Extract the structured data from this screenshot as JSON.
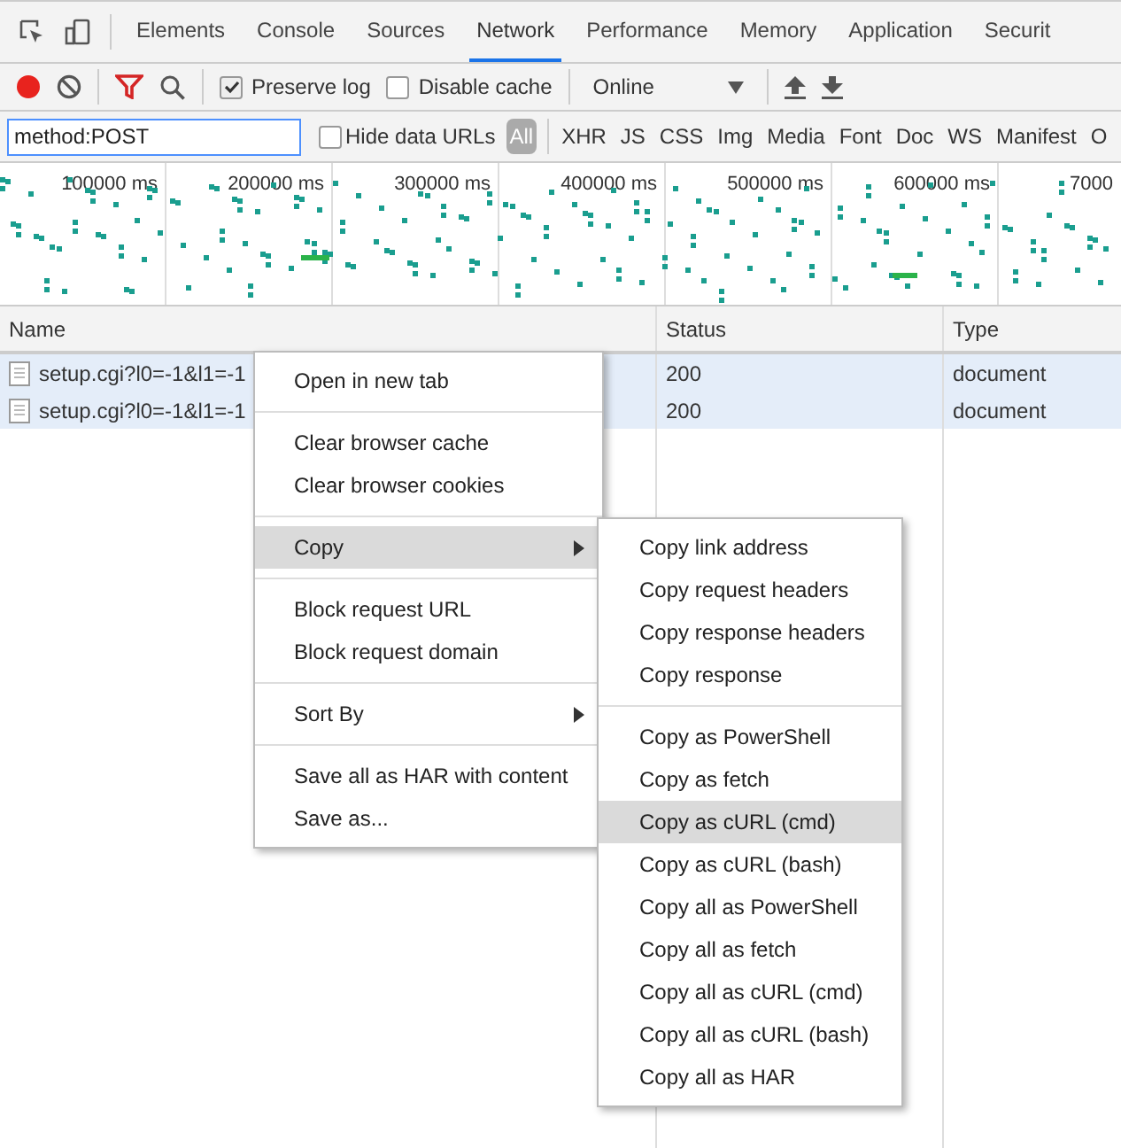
{
  "tabs": [
    {
      "label": "Elements",
      "selected": false
    },
    {
      "label": "Console",
      "selected": false
    },
    {
      "label": "Sources",
      "selected": false
    },
    {
      "label": "Network",
      "selected": true
    },
    {
      "label": "Performance",
      "selected": false
    },
    {
      "label": "Memory",
      "selected": false
    },
    {
      "label": "Application",
      "selected": false
    },
    {
      "label": "Securit",
      "selected": false
    }
  ],
  "toolbar": {
    "recording": true,
    "preserve_log": {
      "label": "Preserve log",
      "checked": true
    },
    "disable_cache": {
      "label": "Disable cache",
      "checked": false
    },
    "throttling": "Online"
  },
  "filter": {
    "value": "method:POST",
    "hide_data_urls": {
      "label": "Hide data URLs",
      "checked": false
    },
    "types": [
      {
        "label": "All",
        "selected": true
      },
      {
        "label": "XHR",
        "selected": false
      },
      {
        "label": "JS",
        "selected": false
      },
      {
        "label": "CSS",
        "selected": false
      },
      {
        "label": "Img",
        "selected": false
      },
      {
        "label": "Media",
        "selected": false
      },
      {
        "label": "Font",
        "selected": false
      },
      {
        "label": "Doc",
        "selected": false
      },
      {
        "label": "WS",
        "selected": false
      },
      {
        "label": "Manifest",
        "selected": false
      },
      {
        "label": "O",
        "selected": false
      }
    ]
  },
  "overview": {
    "ticks": [
      "100000 ms",
      "200000 ms",
      "300000 ms",
      "400000 ms",
      "500000 ms",
      "600000 ms",
      "7000"
    ]
  },
  "table": {
    "columns": [
      "Name",
      "Status",
      "Type"
    ],
    "rows": [
      {
        "name": "setup.cgi?l0=-1&l1=-1",
        "status": "200",
        "type": "document",
        "selected": true
      },
      {
        "name": "setup.cgi?l0=-1&l1=-1",
        "status": "200",
        "type": "document",
        "selected": true
      }
    ]
  },
  "context_menu": {
    "groups": [
      [
        {
          "label": "Open in new tab",
          "highlighted": false,
          "submenu": false
        }
      ],
      [
        {
          "label": "Clear browser cache",
          "highlighted": false,
          "submenu": false
        },
        {
          "label": "Clear browser cookies",
          "highlighted": false,
          "submenu": false
        }
      ],
      [
        {
          "label": "Copy",
          "highlighted": true,
          "submenu": true
        }
      ],
      [
        {
          "label": "Block request URL",
          "highlighted": false,
          "submenu": false
        },
        {
          "label": "Block request domain",
          "highlighted": false,
          "submenu": false
        }
      ],
      [
        {
          "label": "Sort By",
          "highlighted": false,
          "submenu": true
        }
      ],
      [
        {
          "label": "Save all as HAR with content",
          "highlighted": false,
          "submenu": false
        },
        {
          "label": "Save as...",
          "highlighted": false,
          "submenu": false
        }
      ]
    ]
  },
  "copy_submenu": {
    "groups": [
      [
        {
          "label": "Copy link address",
          "highlighted": false
        },
        {
          "label": "Copy request headers",
          "highlighted": false
        },
        {
          "label": "Copy response headers",
          "highlighted": false
        },
        {
          "label": "Copy response",
          "highlighted": false
        }
      ],
      [
        {
          "label": "Copy as PowerShell",
          "highlighted": false
        },
        {
          "label": "Copy as fetch",
          "highlighted": false
        },
        {
          "label": "Copy as cURL (cmd)",
          "highlighted": true
        },
        {
          "label": "Copy as cURL (bash)",
          "highlighted": false
        },
        {
          "label": "Copy all as PowerShell",
          "highlighted": false
        },
        {
          "label": "Copy all as fetch",
          "highlighted": false
        },
        {
          "label": "Copy all as cURL (cmd)",
          "highlighted": false
        },
        {
          "label": "Copy all as cURL (bash)",
          "highlighted": false
        },
        {
          "label": "Copy all as HAR",
          "highlighted": false
        }
      ]
    ]
  }
}
